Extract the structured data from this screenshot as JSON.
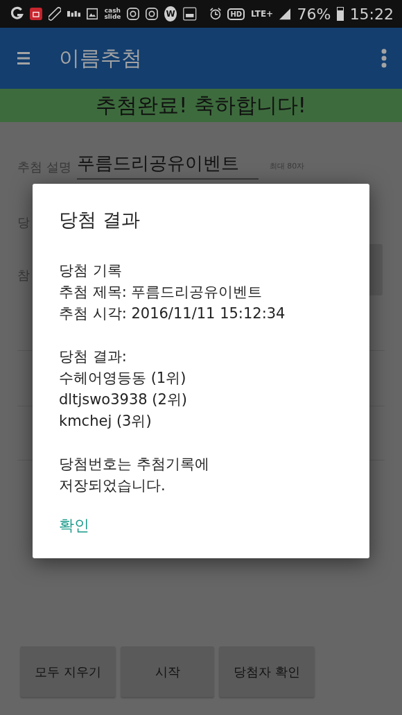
{
  "status_bar": {
    "notifications": [
      {
        "kind": "g-logo"
      },
      {
        "kind": "bag"
      },
      {
        "kind": "pill"
      },
      {
        "kind": "wordmark"
      },
      {
        "kind": "image"
      },
      {
        "kind": "cash-slide",
        "label": "cash slide"
      },
      {
        "kind": "camera"
      },
      {
        "kind": "camera"
      },
      {
        "kind": "w-circle",
        "label": "W"
      },
      {
        "kind": "slide-box"
      }
    ],
    "system": [
      {
        "kind": "alarm"
      },
      {
        "kind": "hd",
        "label": "HD"
      },
      {
        "kind": "lte",
        "label": "LTE+"
      },
      {
        "kind": "signal"
      }
    ],
    "battery_text": "76%",
    "time": "15:22"
  },
  "app_bar": {
    "title": "이름추첨"
  },
  "banner": {
    "text": "추첨완료! 축하합니다!"
  },
  "form": {
    "description_label": "추첨 설명",
    "description_value": "푸름드리공유이벤트",
    "description_hint": "최대 80자",
    "cut_labels": [
      "당",
      "참"
    ]
  },
  "buttons": [
    "모두 지우기",
    "시작",
    "당첨자 확인"
  ],
  "dialog": {
    "title": "당첨 결과",
    "paragraphs": [
      [
        "당첨 기록",
        "추첨 제목: 푸름드리공유이벤트",
        "추첨 시각: 2016/11/11 15:12:34"
      ],
      [
        "당첨 결과:",
        "수헤어영등동 (1위)",
        "dltjswo3938 (2위)",
        "kmchej (3위)"
      ],
      [
        "당첨번호는 추첨기록에",
        "저장되었습니다."
      ]
    ],
    "ok": "확인"
  }
}
